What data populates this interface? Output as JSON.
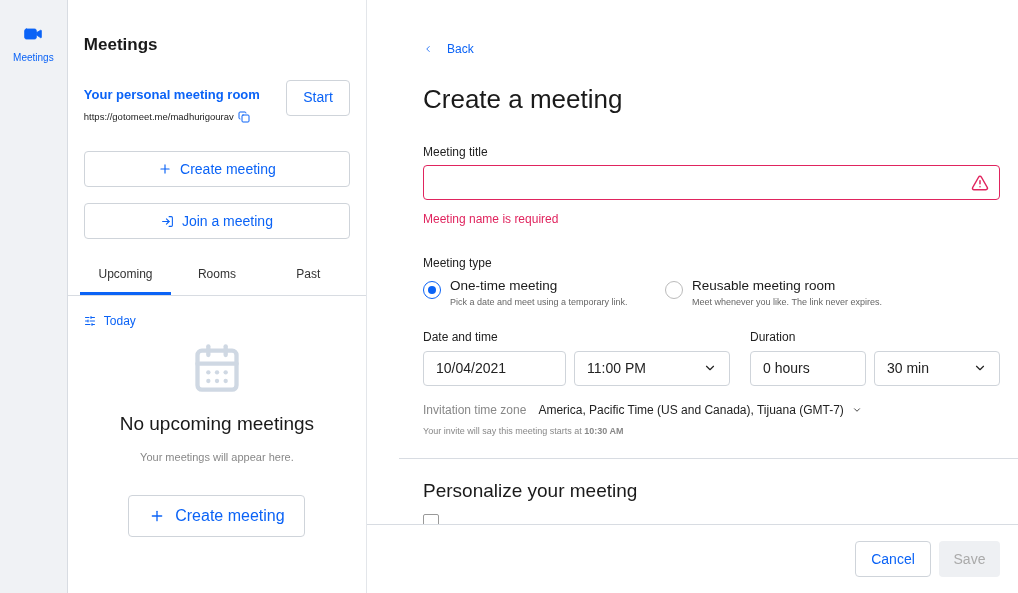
{
  "rail": {
    "items": [
      {
        "label": "Meetings",
        "selected": true
      }
    ]
  },
  "sidebar": {
    "title": "Meetings",
    "personal_room": {
      "title": "Your personal meeting room",
      "url": "https://gotomeet.me/madhurigourav",
      "start_button": "Start"
    },
    "create_button": "Create meeting",
    "join_button": "Join a meeting",
    "tabs": [
      {
        "label": "Upcoming",
        "selected": true
      },
      {
        "label": "Rooms",
        "selected": false
      },
      {
        "label": "Past",
        "selected": false
      }
    ],
    "filter": "Today",
    "empty_title": "No upcoming meetings",
    "empty_text": "Your meetings will appear here.",
    "empty_button": "Create meeting"
  },
  "form": {
    "back": "Back",
    "title": "Create a meeting",
    "meeting_title": {
      "label": "Meeting title",
      "error": "Meeting name is required"
    },
    "meeting_type": {
      "label": "Meeting type",
      "options": [
        {
          "title": "One-time meeting",
          "description": "Pick a date and meet using a temporary link.",
          "selected": true
        },
        {
          "title": "Reusable meeting room",
          "description": "Meet whenever you like. The link never expires.",
          "selected": false
        }
      ]
    },
    "date_label": "Date and time",
    "date": "10/04/2021",
    "time": "11:00 PM",
    "duration_label": "Duration",
    "hours": "0 hours",
    "minutes": "30 min",
    "timezone_label": "Invitation time zone",
    "timezone": "America, Pacific Time (US and Canada), Tijuana (GMT-7)",
    "invite_note": "Your invite will say this meeting starts at **10:30 AM**",
    "personalize_title": "Personalize your meeting",
    "personalize_checkbox": {
      "checked": false
    }
  },
  "footer": {
    "cancel": "Cancel",
    "save": "Save",
    "save_disabled": true
  }
}
